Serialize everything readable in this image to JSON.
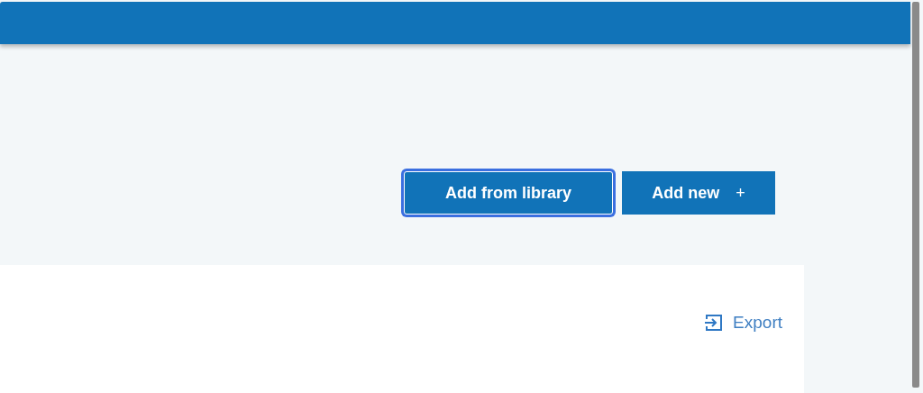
{
  "actions": [
    {
      "label": "Add from library",
      "focused": true
    },
    {
      "label": "Add new",
      "focused": false,
      "icon": "+"
    }
  ],
  "card": {
    "export_link": "Export"
  }
}
